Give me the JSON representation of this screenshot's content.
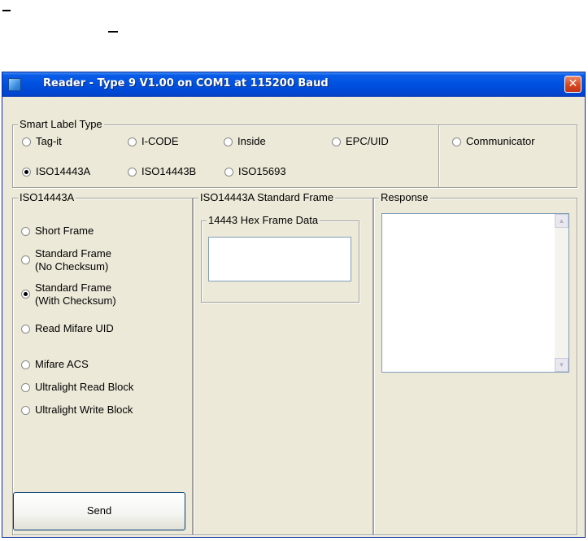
{
  "window": {
    "title": "Reader - Type 9 V1.00 on COM1 at 115200 Baud",
    "close_glyph": "✕"
  },
  "smart_label": {
    "legend": "Smart Label Type",
    "options": [
      {
        "label": "Tag-it",
        "selected": false
      },
      {
        "label": "I-CODE",
        "selected": false
      },
      {
        "label": "Inside",
        "selected": false
      },
      {
        "label": "EPC/UID",
        "selected": false
      },
      {
        "label": "Communicator",
        "selected": false
      },
      {
        "label": "ISO14443A",
        "selected": true
      },
      {
        "label": "ISO14443B",
        "selected": false
      },
      {
        "label": "ISO15693",
        "selected": false
      }
    ]
  },
  "iso_panel": {
    "legend": "ISO14443A",
    "options": [
      {
        "label": "Short Frame",
        "selected": false
      },
      {
        "label": "Standard Frame\n(No Checksum)",
        "selected": false
      },
      {
        "label": "Standard Frame\n(With Checksum)",
        "selected": true
      },
      {
        "label": "Read Mifare UID",
        "selected": false
      },
      {
        "label": "Mifare ACS",
        "selected": false
      },
      {
        "label": "Ultralight Read Block",
        "selected": false
      },
      {
        "label": "Ultralight Write Block",
        "selected": false
      }
    ],
    "send_label": "Send"
  },
  "frame_panel": {
    "legend": "ISO14443A Standard Frame",
    "hex_legend": "14443 Hex Frame Data",
    "hex_value": ""
  },
  "response_panel": {
    "legend": "Response",
    "value": ""
  },
  "colors": {
    "title_bar": "#0050e0",
    "close_button": "#d8461e",
    "window_face": "#ece9d8"
  }
}
